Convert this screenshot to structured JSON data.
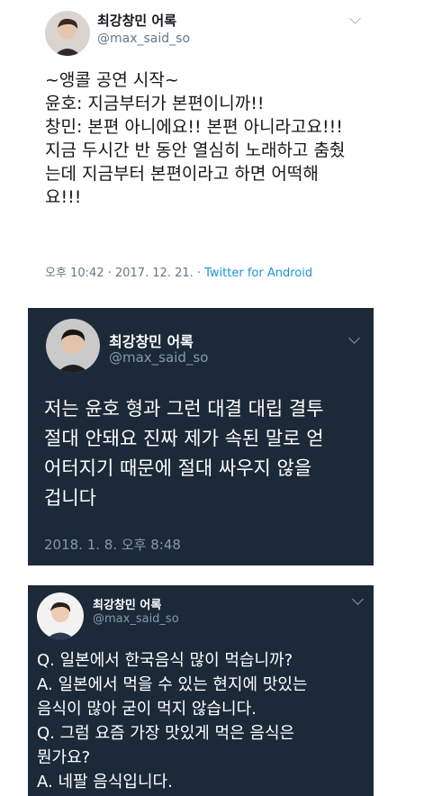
{
  "tweets": [
    {
      "name": "최강창민 어록",
      "handle": "@max_said_so",
      "text": "~앵콜 공연 시작~\n윤호: 지금부터가 본편이니까!!\n창민: 본편 아니에요!! 본편 아니라고요!!!\n지금 두시간 반 동안 열심히 노래하고 춤췄\n는데 지금부터 본편이라고 하면 어떡해\n요!!!",
      "time": "오후 10:42 · 2017. 12. 21. · ",
      "source": "Twitter for Android"
    },
    {
      "name": "최강창민 어록",
      "handle": "@max_said_so",
      "text": "저는 윤호 형과 그런 대결 대립 결투\n절대 안돼요 진짜 제가 속된 말로 얻\n어터지기 때문에 절대 싸우지 않을\n겁니다",
      "time": "2018. 1. 8. 오후 8:48"
    },
    {
      "name": "최강창민 어록",
      "handle": "@max_said_so",
      "text": "Q. 일본에서 한국음식 많이 먹습니까?\nA. 일본에서 먹을 수 있는 현지에 맛있는\n음식이 많아 굳이 먹지 않습니다.\nQ. 그럼 요즘 가장 맛있게 먹은 음식은\n뭔가요?\nA. 네팔 음식입니다."
    }
  ],
  "colors": {
    "dark_card": "#1c2938",
    "link": "#1b95e0",
    "muted_light": "#657786",
    "muted_dark": "#8899a6"
  },
  "icons": [
    "chevron-down-icon",
    "avatar"
  ]
}
